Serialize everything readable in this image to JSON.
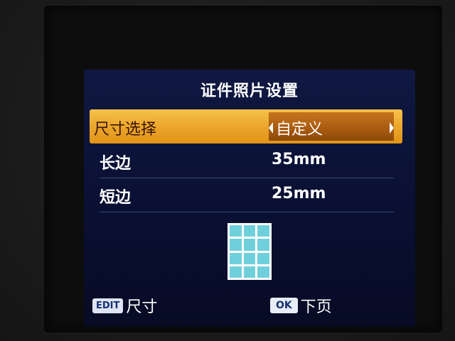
{
  "screen": {
    "title": "证件照片设置",
    "rows": [
      {
        "label": "尺寸选择",
        "value": "自定义",
        "selected": true
      },
      {
        "label": "长边",
        "value": "35mm"
      },
      {
        "label": "短边",
        "value": "25mm"
      }
    ],
    "footer": {
      "edit_key": "EDIT",
      "edit_label": "尺寸",
      "ok_key": "OK",
      "ok_label": "下页"
    }
  },
  "colors": {
    "highlight": "#eba62c",
    "value_box": "#a85a10",
    "background": "#0a1032",
    "preview": "#6fd0dc"
  },
  "icons": [
    "left-arrow-icon",
    "right-arrow-icon",
    "photo-grid-icon"
  ]
}
